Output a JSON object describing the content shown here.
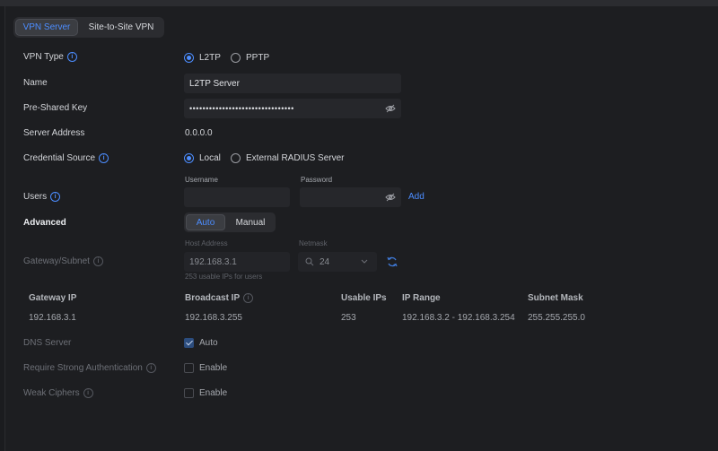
{
  "tabs": [
    {
      "label": "VPN Server"
    },
    {
      "label": "Site-to-Site VPN"
    }
  ],
  "vpn_type": {
    "label": "VPN Type",
    "options": [
      "L2TP",
      "PPTP"
    ],
    "selected": "L2TP"
  },
  "name": {
    "label": "Name",
    "value": "L2TP Server"
  },
  "psk": {
    "label": "Pre-Shared Key",
    "value": "••••••••••••••••••••••••••••••••"
  },
  "server_address": {
    "label": "Server Address",
    "value": "0.0.0.0"
  },
  "credential_source": {
    "label": "Credential Source",
    "options": [
      "Local",
      "External RADIUS Server"
    ],
    "selected": "Local"
  },
  "users": {
    "label": "Users",
    "username_label": "Username",
    "password_label": "Password",
    "add_label": "Add",
    "username_value": "",
    "password_value": ""
  },
  "advanced": {
    "label": "Advanced",
    "options": [
      "Auto",
      "Manual"
    ],
    "selected": "Auto"
  },
  "gateway_subnet": {
    "label": "Gateway/Subnet",
    "host_address_label": "Host Address",
    "host_address_value": "192.168.3.1",
    "hint": "253 usable IPs for users",
    "netmask_label": "Netmask",
    "netmask_value": "24"
  },
  "ip_table": {
    "headers": [
      "Gateway IP",
      "Broadcast IP",
      "Usable IPs",
      "IP Range",
      "Subnet Mask"
    ],
    "row": [
      "192.168.3.1",
      "192.168.3.255",
      "253",
      "192.168.3.2 - 192.168.3.254",
      "255.255.255.0"
    ]
  },
  "dns_server": {
    "label": "DNS Server",
    "option": "Auto",
    "checked": true
  },
  "strong_auth": {
    "label": "Require Strong Authentication",
    "option": "Enable",
    "checked": false
  },
  "weak_ciphers": {
    "label": "Weak Ciphers",
    "option": "Enable",
    "checked": false
  },
  "colors": {
    "accent": "#4c8dff",
    "background": "#1d1e21",
    "input": "#26272b"
  }
}
